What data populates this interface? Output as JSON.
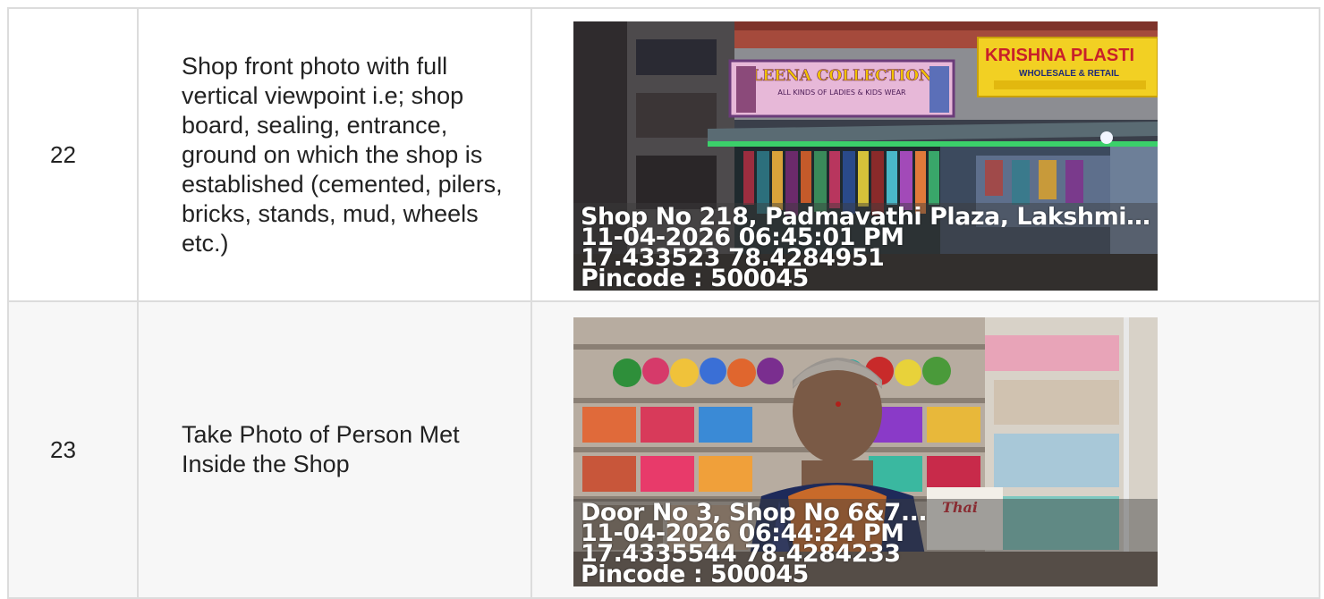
{
  "rows": [
    {
      "number": "22",
      "description": "Shop front photo with full vertical viewpoint i.e; shop board, sealing, entrance, ground on which the shop is established (cemented, pilers, bricks, stands, mud, wheels etc.)",
      "photo": {
        "address": "Shop No 218, Padmavathi Plaza, Lakshmi ...",
        "datetime": "11-04-2026 06:45:01 PM",
        "coordinates": "17.433523 78.4284951",
        "pincode": "Pincode : 500045",
        "signs": {
          "left_board": "ALEENA COLLECTIONS",
          "left_board_sub": "ALL KINDS OF LADIES & KIDS WEAR",
          "right_board": "KRISHNA PLASTI",
          "right_board_sub": "WHOLESALE & RETAIL"
        }
      }
    },
    {
      "number": "23",
      "description": "Take Photo of Person Met Inside the Shop",
      "photo": {
        "address": "Door No 3, Shop No 6&7...",
        "datetime": "11-04-2026 06:44:24 PM",
        "coordinates": "17.4335544 78.4284233",
        "pincode": "Pincode : 500045",
        "signs": {
          "bag_label": "Thai"
        }
      }
    }
  ]
}
